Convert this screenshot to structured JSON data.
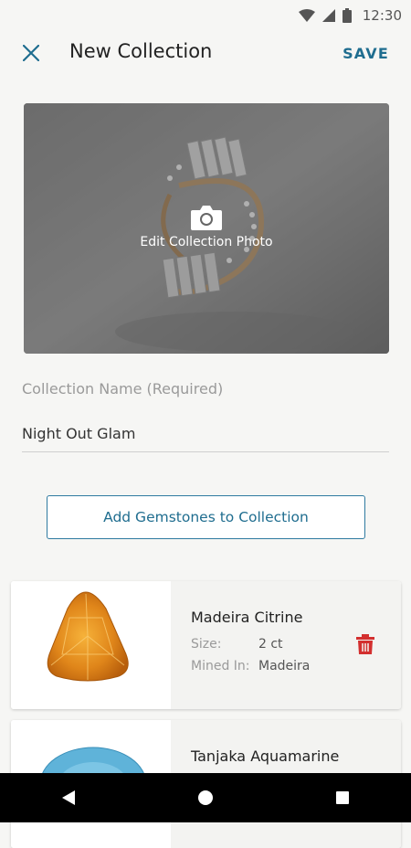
{
  "status_bar": {
    "time": "12:30"
  },
  "header": {
    "title": "New Collection",
    "save_label": "SAVE"
  },
  "photo": {
    "edit_label": "Edit Collection Photo"
  },
  "form": {
    "name_label": "Collection Name (Required)",
    "name_value": "Night Out Glam"
  },
  "add_button_label": "Add Gemstones to Collection",
  "gemstones": [
    {
      "name": "Madeira Citrine",
      "size_label": "Size:",
      "size": "2 ct",
      "mined_label": "Mined In:",
      "mined": "Madeira",
      "color": "#e0861a"
    },
    {
      "name": "Tanjaka Aquamarine",
      "color": "#5fb3d9"
    }
  ],
  "nav": {
    "back": "back-icon",
    "home": "home-icon",
    "recents": "recents-icon"
  },
  "colors": {
    "accent": "#1f6d8f",
    "delete": "#d32f2f"
  }
}
